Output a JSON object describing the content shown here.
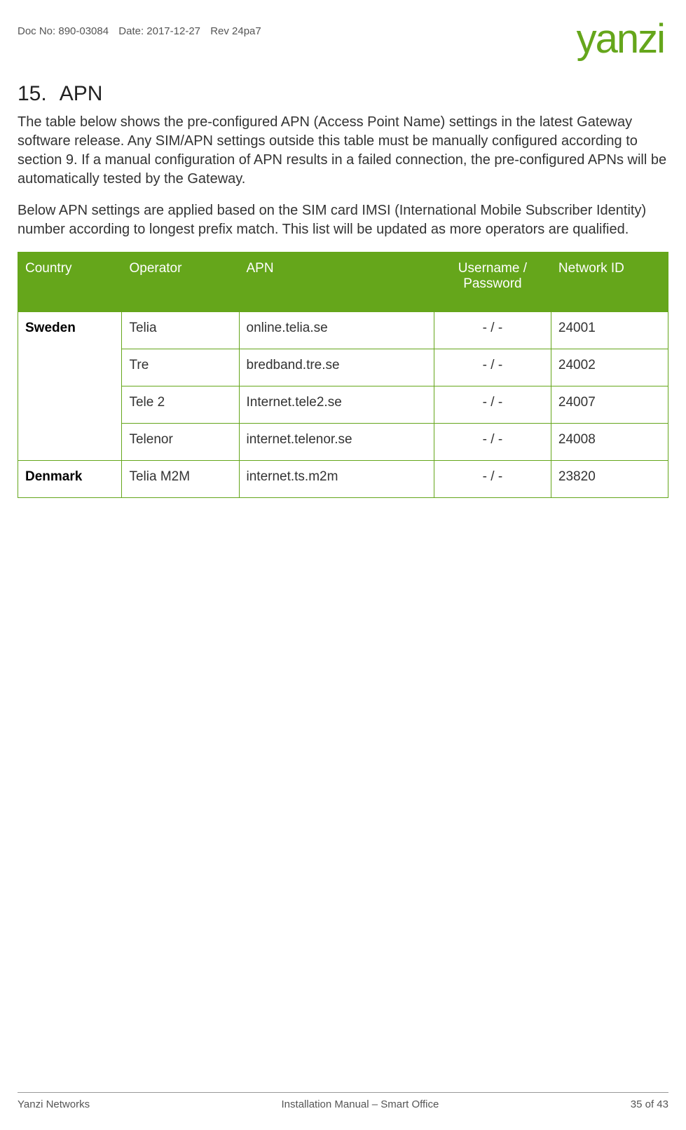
{
  "header": {
    "doc_no_label": "Doc No: 890-03084",
    "date_label": "Date: 2017-12-27",
    "rev_label": "Rev  24pa7",
    "logo_text": "yanzi"
  },
  "section": {
    "number": "15.",
    "title": "APN",
    "para1": "The table below shows the pre-configured APN (Access Point Name) settings in the latest Gateway software release. Any SIM/APN settings outside this table must be manually configured according to section 9. If a manual configuration of APN results in a failed connection, the pre-configured APNs will be automatically tested by the Gateway.",
    "para2": "Below APN settings are applied based on the SIM card IMSI (International Mobile Subscriber Identity) number according to longest prefix match. This list will be updated as more operators are qualified."
  },
  "table": {
    "headers": {
      "country": "Country",
      "operator": "Operator",
      "apn": "APN",
      "userpass": "Username / Password",
      "network_id": "Network ID"
    },
    "groups": [
      {
        "country": "Sweden",
        "rows": [
          {
            "operator": "Telia",
            "apn": "online.telia.se",
            "userpass": "- / -",
            "network_id": "24001"
          },
          {
            "operator": "Tre",
            "apn": "bredband.tre.se",
            "userpass": "- / -",
            "network_id": "24002"
          },
          {
            "operator": "Tele 2",
            "apn": "Internet.tele2.se",
            "userpass": "- / -",
            "network_id": "24007"
          },
          {
            "operator": "Telenor",
            "apn": "internet.telenor.se",
            "userpass": "- / -",
            "network_id": "24008"
          }
        ]
      },
      {
        "country": "Denmark",
        "rows": [
          {
            "operator": "Telia M2M",
            "apn": "internet.ts.m2m",
            "userpass": "- / -",
            "network_id": "23820"
          }
        ]
      }
    ]
  },
  "footer": {
    "left": "Yanzi Networks",
    "center": "Installation Manual – Smart Office",
    "right": "35 of 43"
  }
}
